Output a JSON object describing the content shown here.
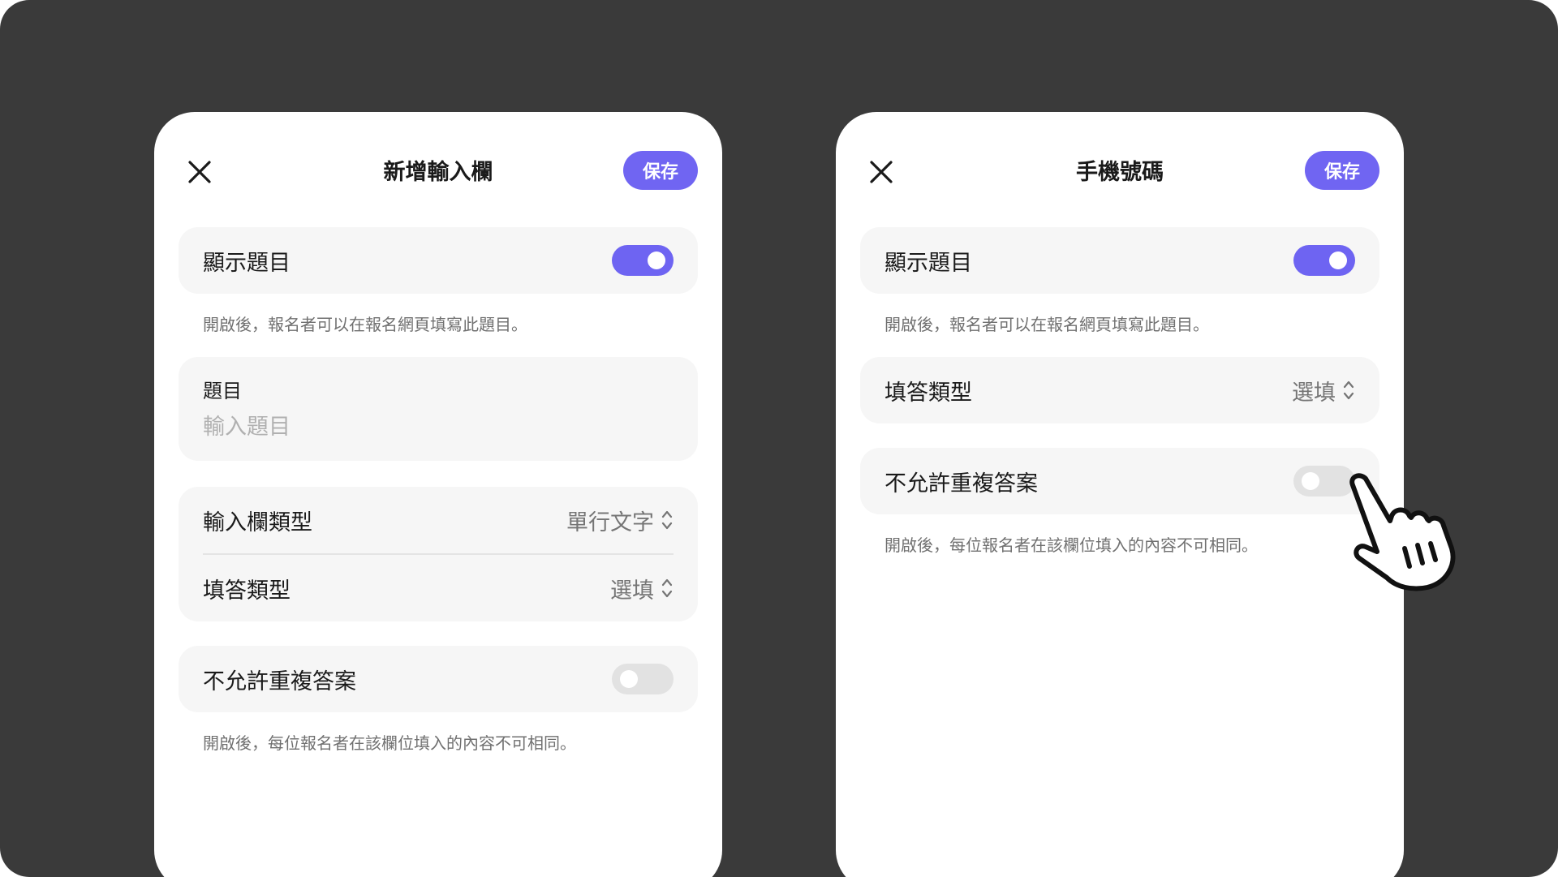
{
  "left_panel": {
    "title": "新增輸入欄",
    "save_label": "保存",
    "show_question": {
      "label": "顯示題目",
      "enabled": true,
      "hint": "開啟後，報名者可以在報名網頁填寫此題目。"
    },
    "question": {
      "label": "題目",
      "placeholder": "輸入題目"
    },
    "input_type": {
      "label": "輸入欄類型",
      "value": "單行文字"
    },
    "answer_type": {
      "label": "填答類型",
      "value": "選填"
    },
    "no_duplicate": {
      "label": "不允許重複答案",
      "enabled": false,
      "hint": "開啟後，每位報名者在該欄位填入的內容不可相同。"
    }
  },
  "right_panel": {
    "title": "手機號碼",
    "save_label": "保存",
    "show_question": {
      "label": "顯示題目",
      "enabled": true,
      "hint": "開啟後，報名者可以在報名網頁填寫此題目。"
    },
    "answer_type": {
      "label": "填答類型",
      "value": "選填"
    },
    "no_duplicate": {
      "label": "不允許重複答案",
      "enabled": false,
      "hint": "開啟後，每位報名者在該欄位填入的內容不可相同。"
    }
  },
  "colors": {
    "accent": "#7065f2",
    "backdrop": "#3a3a3a",
    "card": "#f6f6f6",
    "toggle_off": "#e2e2e2"
  },
  "icons": [
    "close-icon",
    "chevron-updown-icon",
    "pointing-hand-cursor-icon"
  ]
}
